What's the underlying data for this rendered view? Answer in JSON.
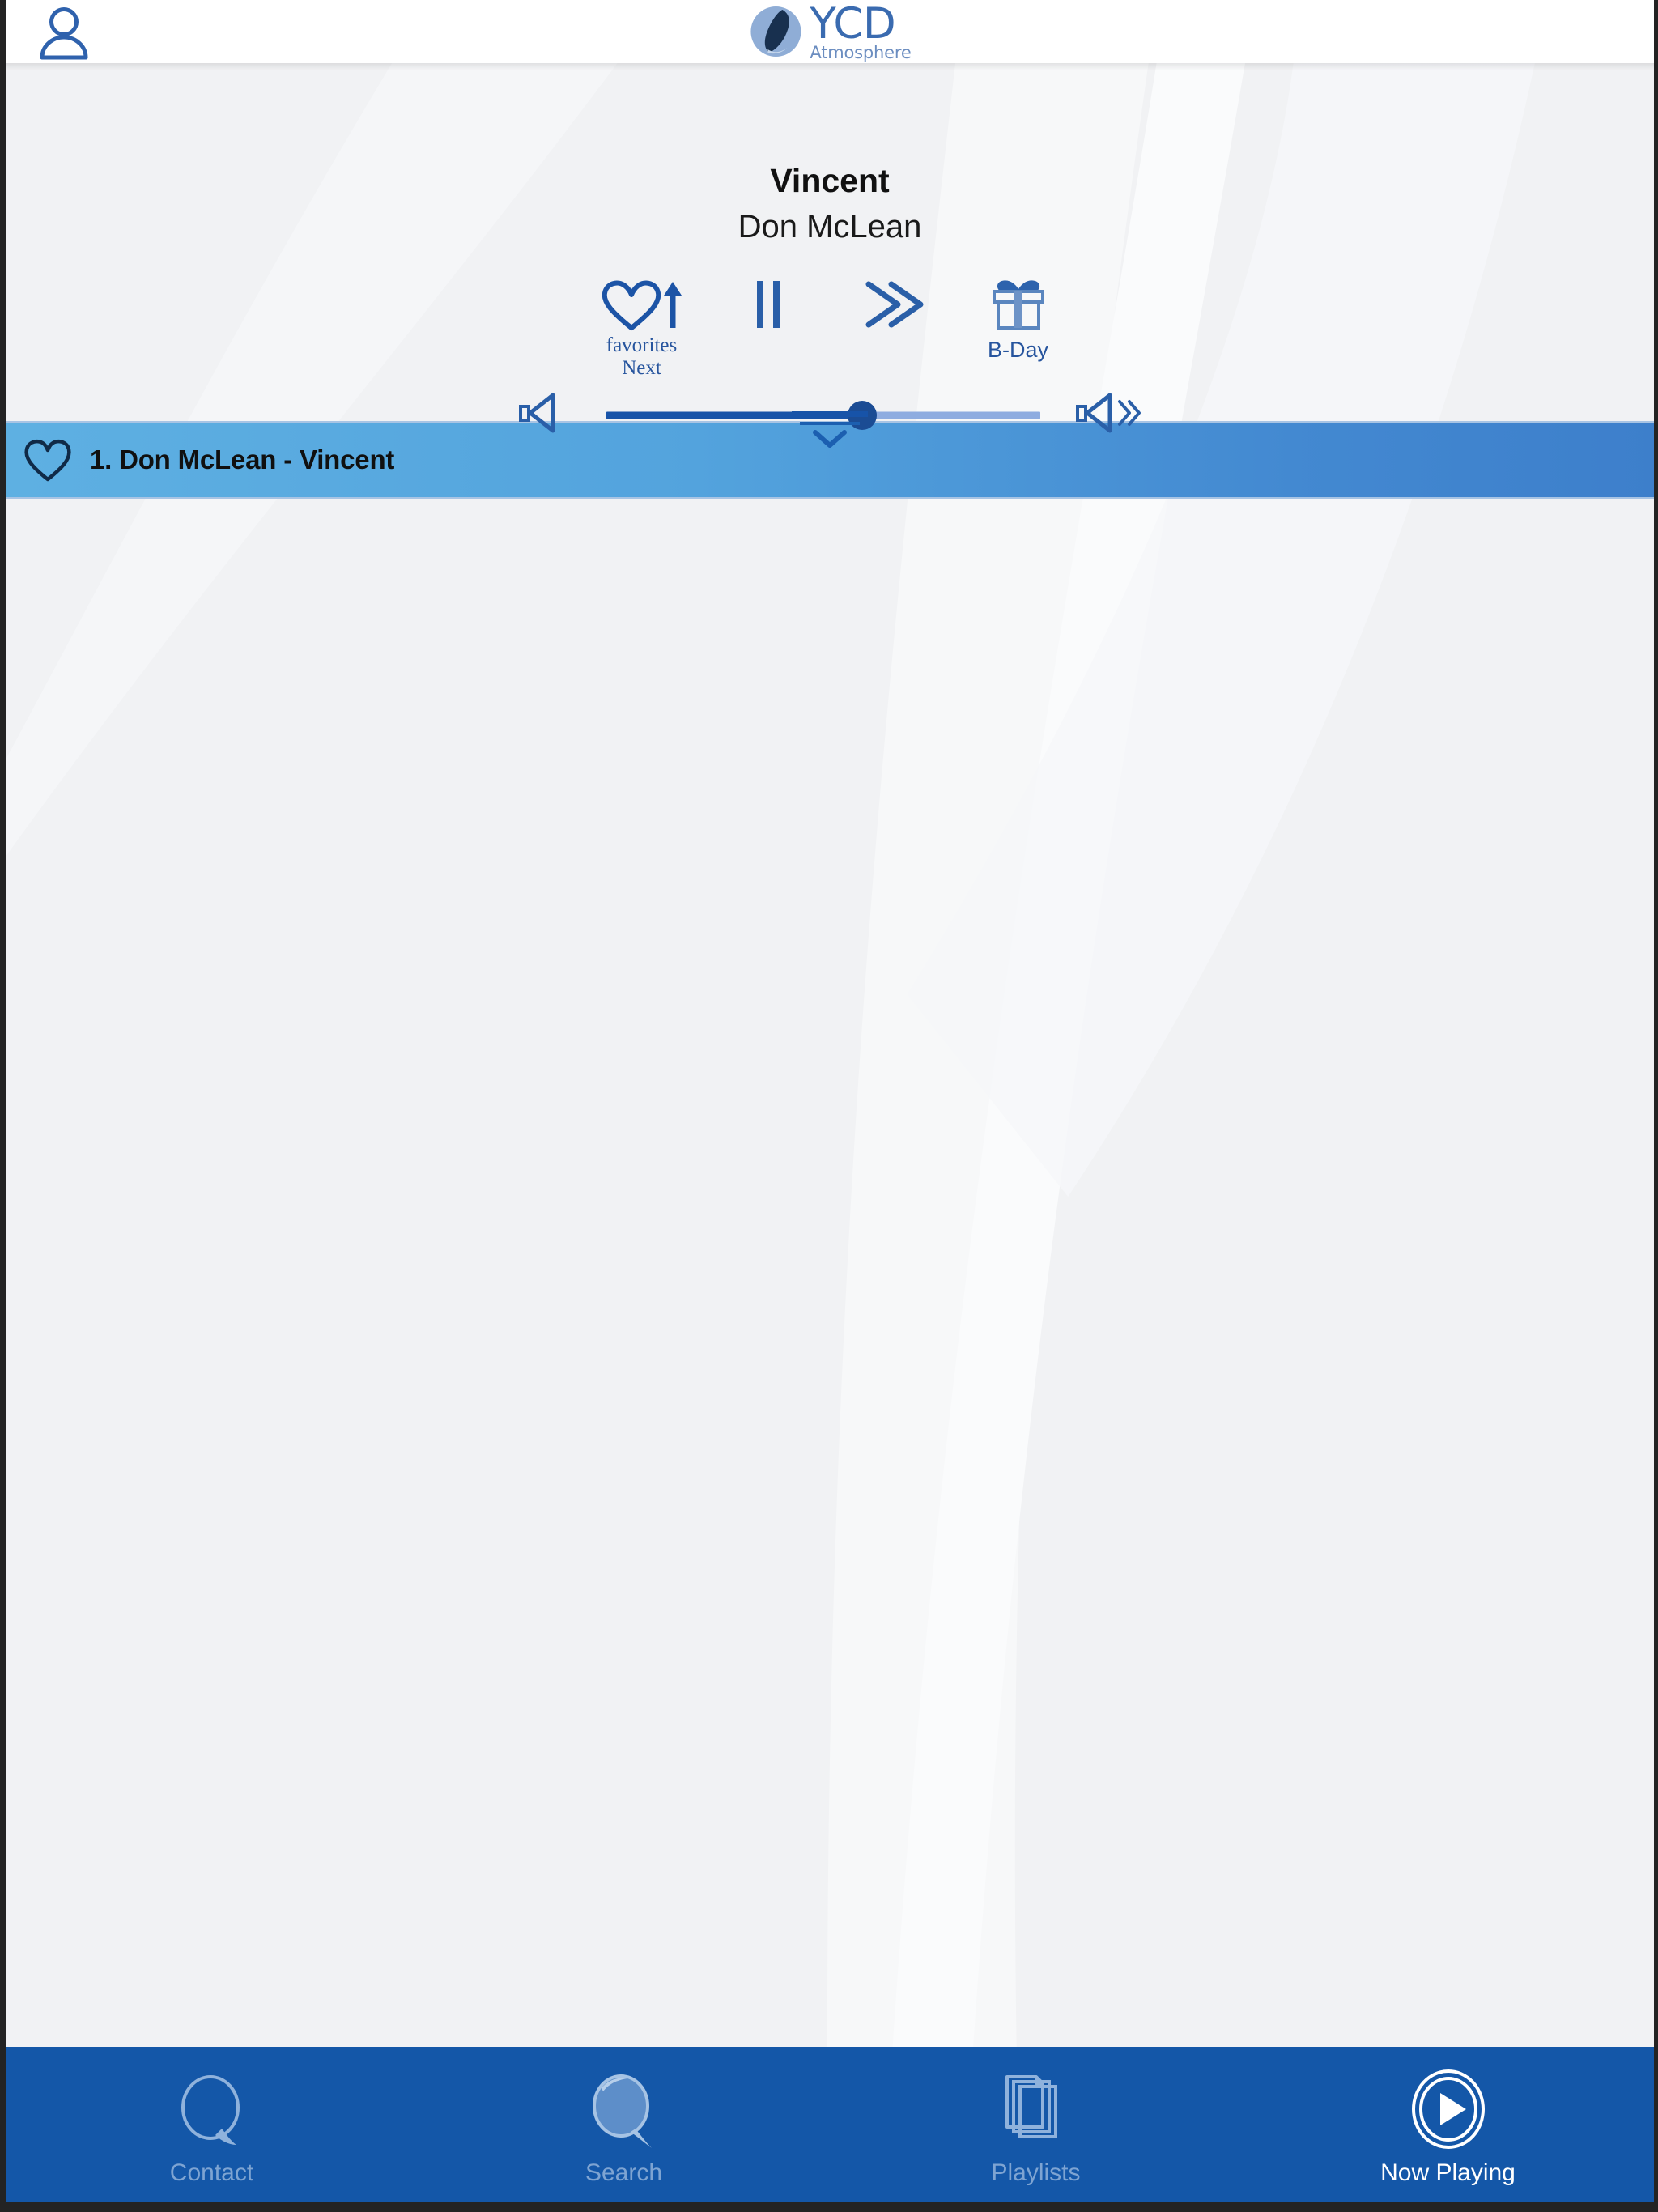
{
  "app": {
    "brand_name": "YCD",
    "brand_tagline": "Atmosphere",
    "accent_blue": "#1457a8",
    "icon_blue": "#27559e",
    "row_blue_light": "#5eb0e2",
    "row_blue_dark": "#3d7fcb",
    "background_gray": "#f1f2f4"
  },
  "header": {
    "account_icon": "user-icon",
    "logo_icon": "ycd-logo-icon"
  },
  "player": {
    "title": "Vincent",
    "artist": "Don McLean",
    "controls": [
      {
        "name": "favorites-next",
        "icon": "heart-with-up-arrow-icon",
        "label_line1": "favorites",
        "label_line2": "Next"
      },
      {
        "name": "pause",
        "icon": "pause-icon",
        "label_line1": "",
        "label_line2": ""
      },
      {
        "name": "next-track",
        "icon": "fast-forward-icon",
        "label_line1": "",
        "label_line2": ""
      },
      {
        "name": "birthday",
        "icon": "gift-icon",
        "label_line1": "B-Day",
        "label_line2": ""
      }
    ],
    "volume": {
      "mute_icon": "speaker-mute-icon",
      "up_icon": "speaker-volume-up-icon",
      "value_percent": 59
    },
    "collapse_icon": "chevron-down-icon"
  },
  "playlist": {
    "tracks": [
      {
        "favorite_icon": "heart-outline-icon",
        "label": "1. Don McLean - Vincent",
        "selected": true
      }
    ]
  },
  "tabbar": {
    "items": [
      {
        "label": "Contact",
        "icon": "speech-bubble-icon",
        "active": false
      },
      {
        "label": "Search",
        "icon": "magnifier-icon",
        "active": false
      },
      {
        "label": "Playlists",
        "icon": "stacked-pages-icon",
        "active": false
      },
      {
        "label": "Now Playing",
        "icon": "play-circle-icon",
        "active": true
      }
    ]
  }
}
